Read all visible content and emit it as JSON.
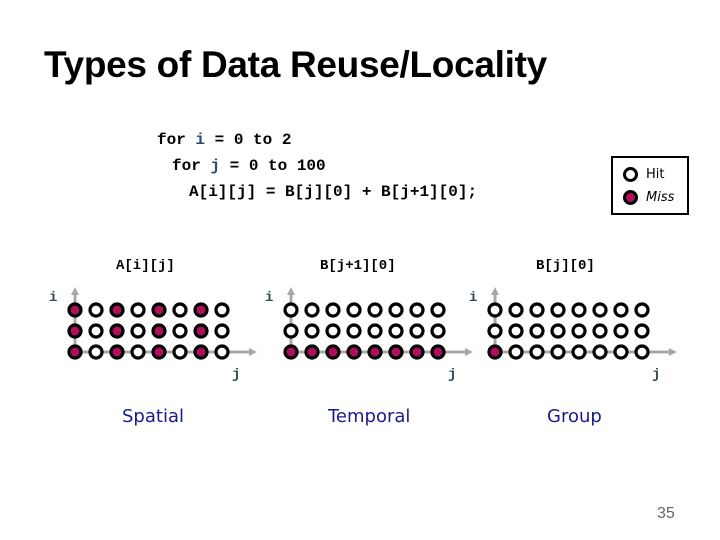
{
  "title": "Types of Data Reuse/Locality",
  "code": {
    "line1": {
      "pre": "for ",
      "var": "i",
      "post": " = 0 to 2"
    },
    "line2": {
      "pre": "for ",
      "var": "j",
      "post": " = 0 to 100"
    },
    "line3": "A[i][j] = B[j][0] + B[j+1][0];"
  },
  "legend": {
    "hit_label": "Hit",
    "miss_label": "Miss",
    "colors": {
      "hit_fill": "#ffffff",
      "miss_fill": "#b0105a",
      "outline": "#000000"
    }
  },
  "panels": [
    {
      "array_label": "A[i][j]",
      "caption": "Spatial",
      "axis_i": "i",
      "axis_j": "j",
      "grid": [
        [
          "miss",
          "hit",
          "miss",
          "hit",
          "miss",
          "hit",
          "miss",
          "hit"
        ],
        [
          "miss",
          "hit",
          "miss",
          "hit",
          "miss",
          "hit",
          "miss",
          "hit"
        ],
        [
          "miss",
          "hit",
          "miss",
          "hit",
          "miss",
          "hit",
          "miss",
          "hit"
        ]
      ]
    },
    {
      "array_label": "B[j+1][0]",
      "caption": "Temporal",
      "axis_i": "i",
      "axis_j": "j",
      "grid": [
        [
          "hit",
          "hit",
          "hit",
          "hit",
          "hit",
          "hit",
          "hit",
          "hit"
        ],
        [
          "hit",
          "hit",
          "hit",
          "hit",
          "hit",
          "hit",
          "hit",
          "hit"
        ],
        [
          "miss",
          "miss",
          "miss",
          "miss",
          "miss",
          "miss",
          "miss",
          "miss"
        ]
      ]
    },
    {
      "array_label": "B[j][0]",
      "caption": "Group",
      "axis_i": "i",
      "axis_j": "j",
      "grid": [
        [
          "hit",
          "hit",
          "hit",
          "hit",
          "hit",
          "hit",
          "hit",
          "hit"
        ],
        [
          "hit",
          "hit",
          "hit",
          "hit",
          "hit",
          "hit",
          "hit",
          "hit"
        ],
        [
          "miss",
          "hit",
          "hit",
          "hit",
          "hit",
          "hit",
          "hit",
          "hit"
        ]
      ]
    }
  ],
  "page_number": "35"
}
